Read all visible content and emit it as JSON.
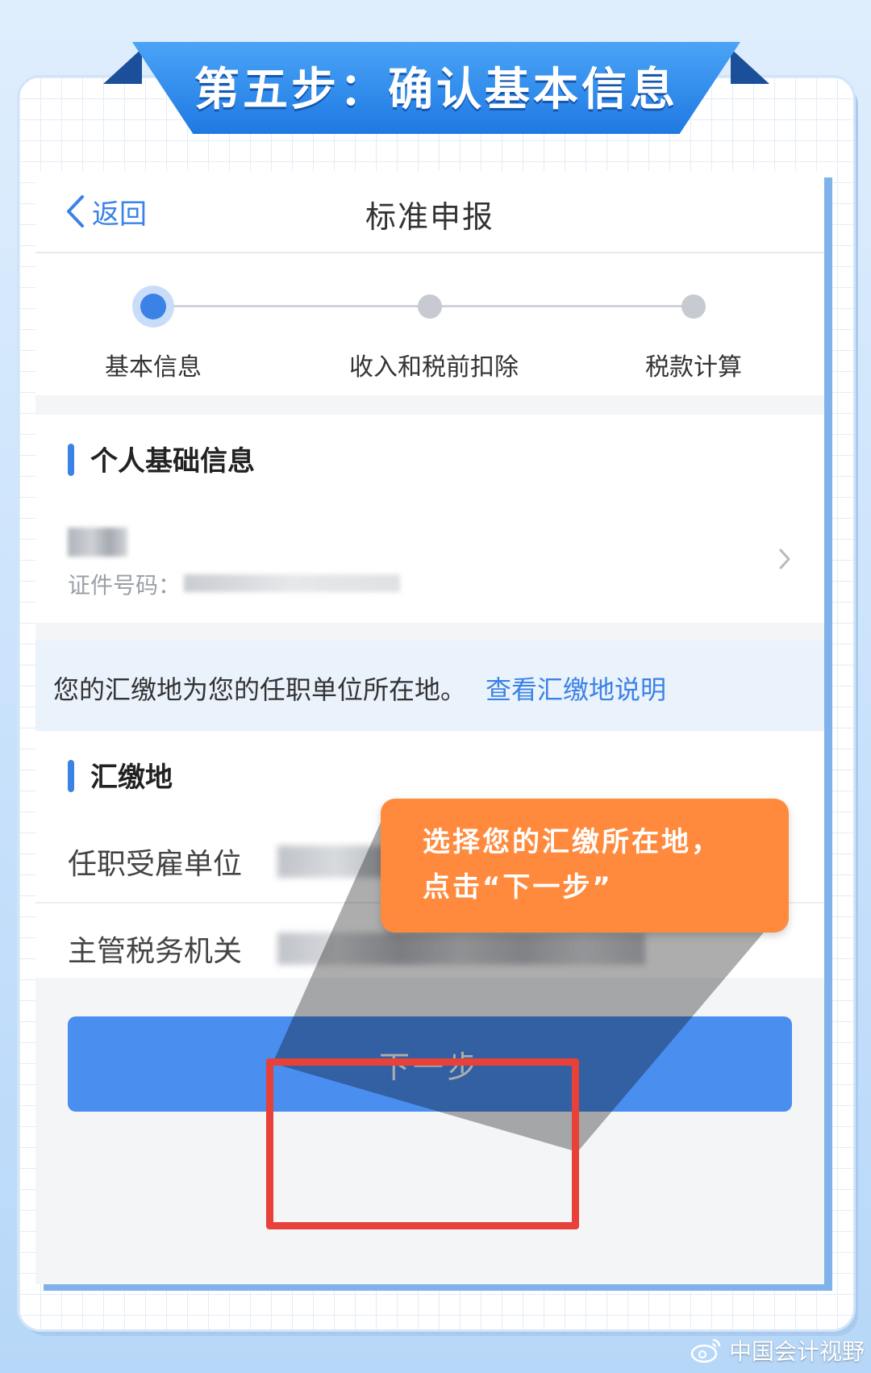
{
  "banner": {
    "title": "第五步：确认基本信息"
  },
  "nav": {
    "back_label": "返回",
    "title": "标准申报"
  },
  "steps": [
    {
      "label": "基本信息",
      "active": true
    },
    {
      "label": "收入和税前扣除",
      "active": false
    },
    {
      "label": "税款计算",
      "active": false
    }
  ],
  "personal_section": {
    "title": "个人基础信息",
    "id_label": "证件号码："
  },
  "notice": {
    "text": "您的汇缴地为您的任职单位所在地。",
    "link": "查看汇缴地说明"
  },
  "remit_section": {
    "title": "汇缴地",
    "rows": [
      {
        "label": "任职受雇单位"
      },
      {
        "label": "主管税务机关"
      }
    ]
  },
  "next_button": {
    "label": "下一步"
  },
  "callout": {
    "line1": "选择您的汇缴所在地，",
    "line2": "点击“下一步”"
  },
  "watermark": {
    "text": "中国会计视野"
  },
  "colors": {
    "accent": "#3b82e6",
    "button": "#4a8ef0",
    "callout": "#ff8a3d",
    "highlight": "#e8413a"
  }
}
